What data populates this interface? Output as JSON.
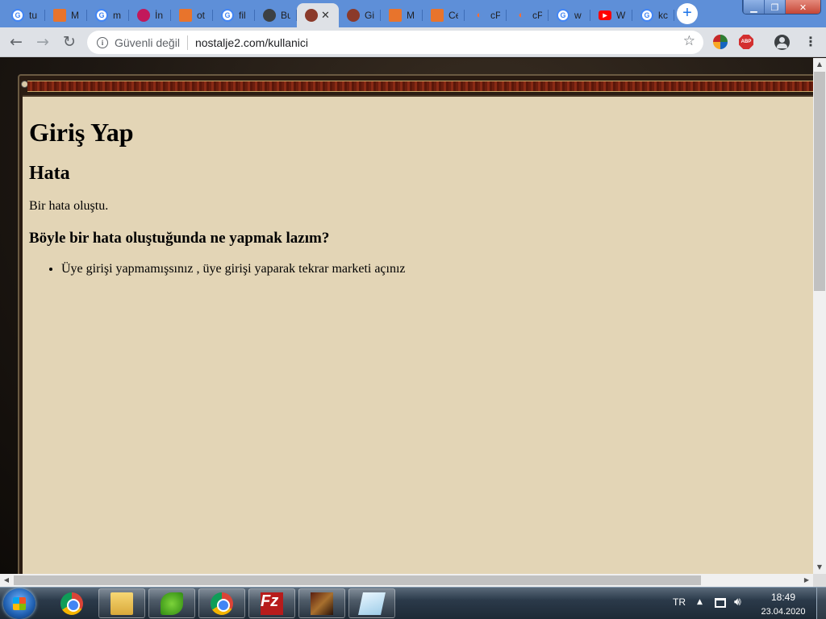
{
  "browser": {
    "tabs": [
      {
        "label": "tu",
        "favicon": "google-icon"
      },
      {
        "label": "M",
        "favicon": "orange-site-icon"
      },
      {
        "label": "m",
        "favicon": "google-icon"
      },
      {
        "label": "İn",
        "favicon": "pink-site-icon"
      },
      {
        "label": "ot",
        "favicon": "orange-site-icon"
      },
      {
        "label": "fil",
        "favicon": "google-icon"
      },
      {
        "label": "Bu",
        "favicon": "globe-icon"
      },
      {
        "label": "",
        "favicon": "game-site-icon",
        "active": true
      },
      {
        "label": "Gi",
        "favicon": "game-site-icon"
      },
      {
        "label": "M",
        "favicon": "orange-site-icon"
      },
      {
        "label": "Ce",
        "favicon": "orange-site-icon"
      },
      {
        "label": "cP",
        "favicon": "cpanel-icon"
      },
      {
        "label": "cP",
        "favicon": "cpanel-icon"
      },
      {
        "label": "w",
        "favicon": "google-icon"
      },
      {
        "label": "W",
        "favicon": "youtube-icon"
      },
      {
        "label": "kc",
        "favicon": "google-icon"
      }
    ],
    "security_label": "Güvenli değil",
    "url": "nostalje2.com/kullanici",
    "extensions": [
      "globe-extension-icon",
      "abp-icon"
    ],
    "abp_text": "ABP"
  },
  "page": {
    "title": "Giriş Yap",
    "error_heading": "Hata",
    "error_message": "Bir hata oluştu.",
    "question": "Böyle bir hata oluştuğunda ne yapmak lazım?",
    "steps": [
      "Üye girişi yapmamışsınız , üye girişi yaparak tekrar marketi açınız"
    ]
  },
  "taskbar": {
    "apps": [
      "chrome-icon",
      "explorer-icon",
      "green-app-icon",
      "chrome-icon",
      "filezilla-icon",
      "game-icon",
      "notepad-icon"
    ],
    "filezilla_glyph": "Fz",
    "language": "TR",
    "time": "18:49",
    "date": "23.04.2020"
  },
  "colors": {
    "tab_strip": "#5e8fd8",
    "toolbar": "#dee1e6",
    "page_panel": "#e3d5b6",
    "frame_border": "#6b1e0e"
  }
}
